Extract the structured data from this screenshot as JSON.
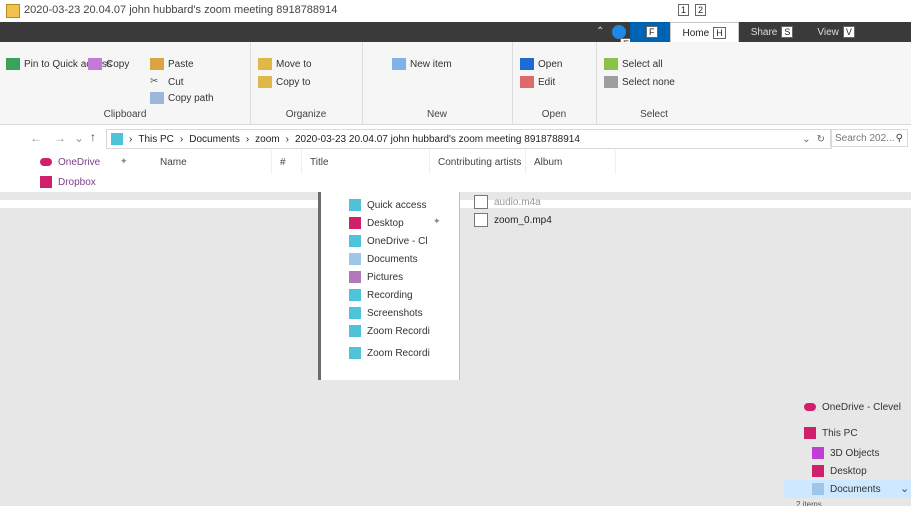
{
  "window": {
    "title": "2020-03-23 20.04.07 john hubbard's zoom meeting 8918788914"
  },
  "ribbon_tabs": [
    {
      "label": "F",
      "keytip": ""
    },
    {
      "label": "Home",
      "keytip": "H"
    },
    {
      "label": "Share",
      "keytip": "S"
    },
    {
      "label": "View",
      "keytip": "V"
    }
  ],
  "title_keytips": [
    "1",
    "2"
  ],
  "help_keytip": "E",
  "ribbon": {
    "clipboard": {
      "label": "Clipboard",
      "pin": "Pin to Quick access",
      "copy": "Copy",
      "paste": "Paste",
      "cut": "Cut",
      "copy_path": "Copy path"
    },
    "organize": {
      "label": "Organize",
      "move": "Move to",
      "copy_to": "Copy to"
    },
    "new": {
      "label": "New",
      "new_item": "New item"
    },
    "open": {
      "label": "Open",
      "open_btn": "Open",
      "edit": "Edit"
    },
    "select": {
      "label": "Select",
      "select_all": "Select all",
      "select_none": "Select none"
    }
  },
  "address": {
    "path": [
      "This PC",
      "Documents",
      "zoom",
      "2020-03-23 20.04.07 john hubbard's zoom meeting 8918788914"
    ],
    "search_placeholder": "Search 202..."
  },
  "columns": [
    "Name",
    "#",
    "Title",
    "Contributing artists",
    "Album"
  ],
  "nav": {
    "onedrive": "OneDrive",
    "dropbox": "Dropbox"
  },
  "popup_items": [
    "Quick access",
    "Desktop",
    "OneDrive - Cl",
    "Documents",
    "Pictures",
    "Recording",
    "Screenshots",
    "Zoom Recordi",
    "Zoom Recordi"
  ],
  "files": [
    {
      "name": "audio.m4a"
    },
    {
      "name": "zoom_0.mp4"
    }
  ],
  "side_items": [
    "OneDrive - Clevel",
    "This PC",
    "3D Objects",
    "Desktop",
    "Documents"
  ],
  "status": "2 items",
  "colors": {
    "accent": "#0063b1",
    "ribbon_band": "#3a3a3a",
    "selected": "#cde8ff",
    "onedrive": "#d0206b"
  }
}
